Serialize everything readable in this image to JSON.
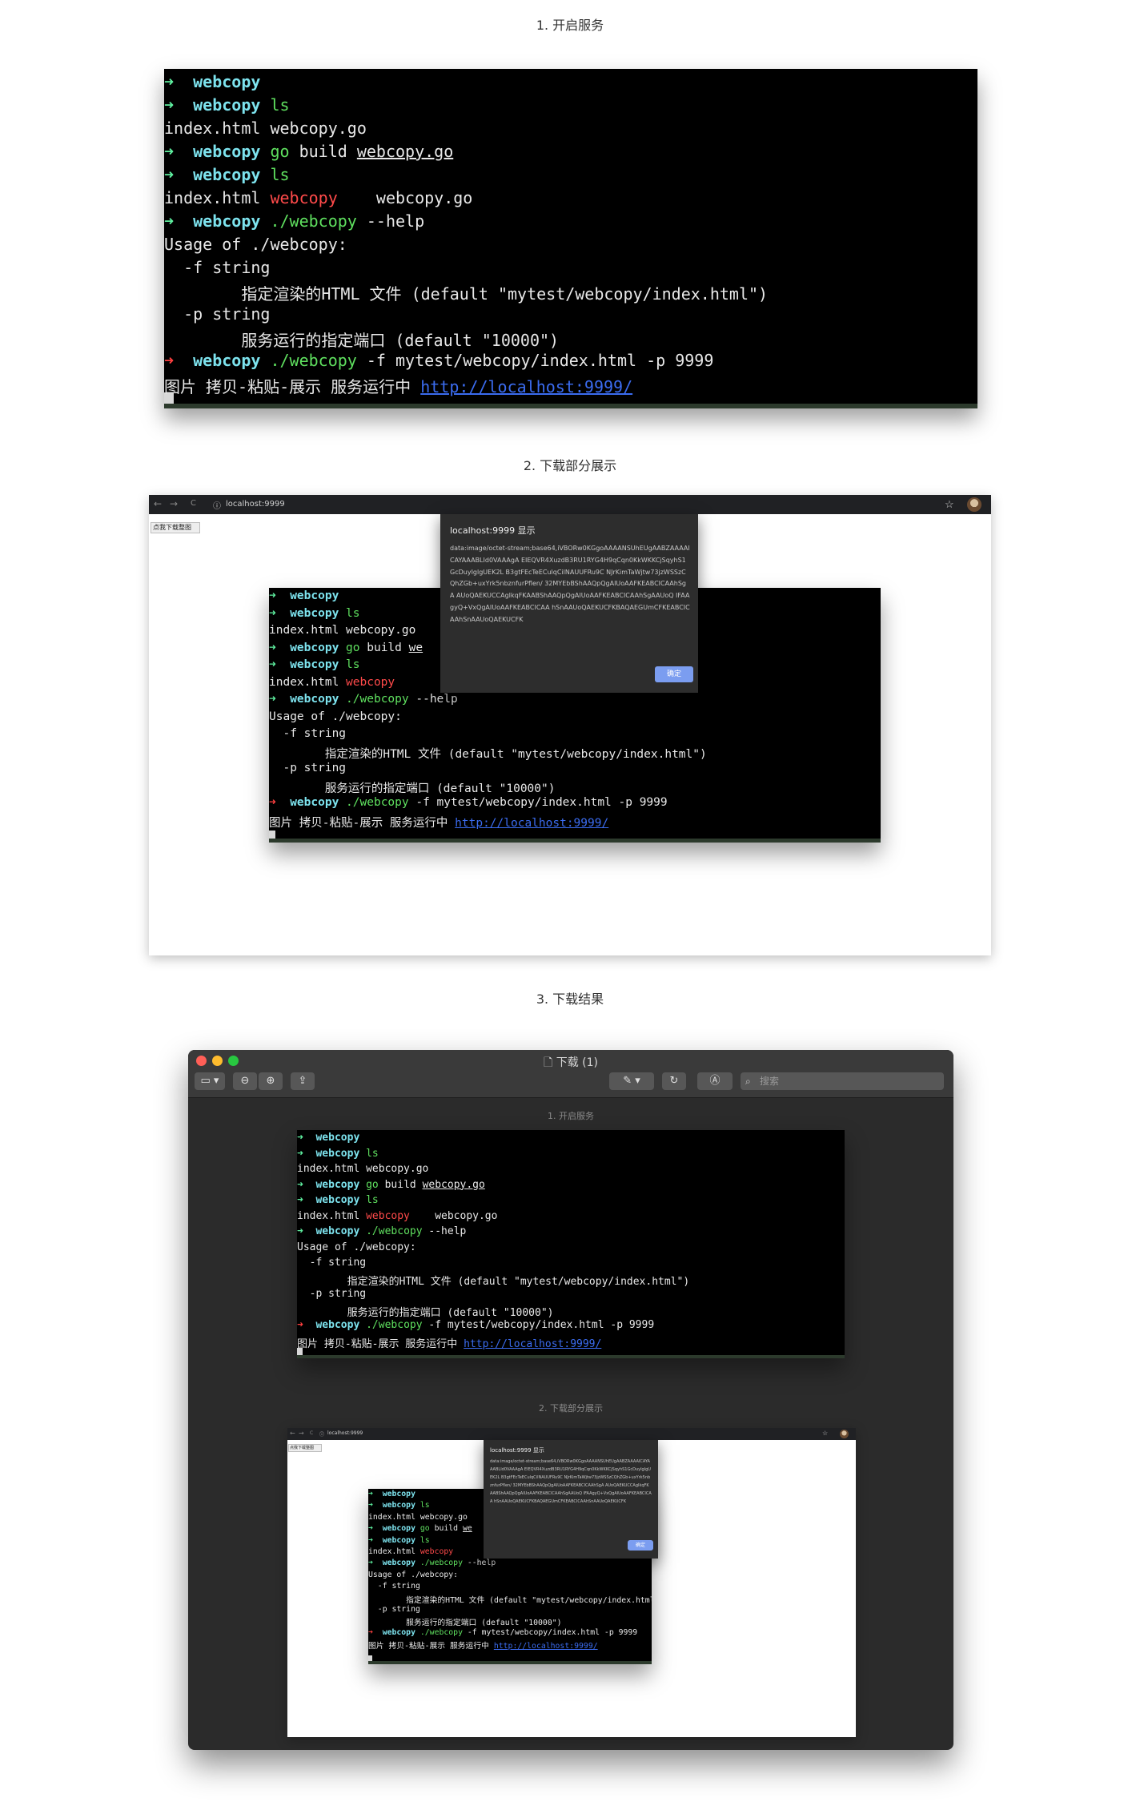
{
  "captions": {
    "step1": "1. 开启服务",
    "step2": "2. 下载部分展示",
    "step3": "3. 下载结果"
  },
  "terminal": {
    "lines": [
      [
        {
          "t": "➜ ",
          "c": "arrow-ok"
        },
        {
          "t": " webcopy",
          "c": "cwd"
        }
      ],
      [
        {
          "t": "➜ ",
          "c": "arrow-ok"
        },
        {
          "t": " webcopy",
          "c": "cwd"
        },
        {
          "t": " ls",
          "c": "cmd"
        }
      ],
      [
        {
          "t": "index.html webcopy.go",
          "c": ""
        }
      ],
      [
        {
          "t": "➜ ",
          "c": "arrow-ok"
        },
        {
          "t": " webcopy",
          "c": "cwd"
        },
        {
          "t": " go",
          "c": "cmd"
        },
        {
          "t": " build ",
          "c": ""
        },
        {
          "t": "webcopy.go",
          "c": "ul"
        }
      ],
      [
        {
          "t": "➜ ",
          "c": "arrow-ok"
        },
        {
          "t": " webcopy",
          "c": "cwd"
        },
        {
          "t": " ls",
          "c": "cmd"
        }
      ],
      [
        {
          "t": "index.html ",
          "c": ""
        },
        {
          "t": "webcopy",
          "c": "red"
        },
        {
          "t": "    webcopy.go",
          "c": ""
        }
      ],
      [
        {
          "t": "➜ ",
          "c": "arrow-ok"
        },
        {
          "t": " webcopy",
          "c": "cwd"
        },
        {
          "t": " ./webcopy",
          "c": "cmd"
        },
        {
          "t": " --help",
          "c": ""
        }
      ],
      [
        {
          "t": "Usage of ./webcopy:",
          "c": ""
        }
      ],
      [
        {
          "t": "  -f string",
          "c": ""
        }
      ],
      [
        {
          "t": "        指定渲染的HTML 文件 (default \"mytest/webcopy/index.html\")",
          "c": ""
        }
      ],
      [
        {
          "t": "  -p string",
          "c": ""
        }
      ],
      [
        {
          "t": "        服务运行的指定端口 (default \"10000\")",
          "c": ""
        }
      ],
      [
        {
          "t": "➜ ",
          "c": "arrow-err"
        },
        {
          "t": " webcopy",
          "c": "cwd"
        },
        {
          "t": " ./webcopy",
          "c": "cmd"
        },
        {
          "t": " -f mytest/webcopy/index.html -p 9999",
          "c": ""
        }
      ],
      [
        {
          "t": "图片 拷贝-粘贴-展示 服务运行中 ",
          "c": ""
        },
        {
          "t": "http://localhost:9999/",
          "c": "link"
        }
      ]
    ]
  },
  "terminal_partial": {
    "lines": [
      [
        {
          "t": "➜ ",
          "c": "arrow-ok"
        },
        {
          "t": " webcopy",
          "c": "cwd"
        }
      ],
      [
        {
          "t": "➜ ",
          "c": "arrow-ok"
        },
        {
          "t": " webcopy",
          "c": "cwd"
        },
        {
          "t": " ls",
          "c": "cmd"
        }
      ],
      [
        {
          "t": "index.html webcopy.go",
          "c": ""
        }
      ],
      [
        {
          "t": "➜ ",
          "c": "arrow-ok"
        },
        {
          "t": " webcopy",
          "c": "cwd"
        },
        {
          "t": " go",
          "c": "cmd"
        },
        {
          "t": " build ",
          "c": ""
        },
        {
          "t": "we",
          "c": "ul"
        }
      ],
      [
        {
          "t": "➜ ",
          "c": "arrow-ok"
        },
        {
          "t": " webcopy",
          "c": "cwd"
        },
        {
          "t": " ls",
          "c": "cmd"
        }
      ],
      [
        {
          "t": "index.html ",
          "c": ""
        },
        {
          "t": "webcopy",
          "c": "red"
        }
      ],
      [
        {
          "t": "➜ ",
          "c": "arrow-ok"
        },
        {
          "t": " webcopy",
          "c": "cwd"
        },
        {
          "t": " ./webcopy",
          "c": "cmd"
        },
        {
          "t": " --help",
          "c": ""
        }
      ],
      [
        {
          "t": "Usage of ./webcopy:",
          "c": ""
        }
      ],
      [
        {
          "t": "  -f string",
          "c": ""
        }
      ],
      [
        {
          "t": "        指定渲染的HTML 文件 (default \"mytest/webcopy/index.html\")",
          "c": ""
        }
      ],
      [
        {
          "t": "  -p string",
          "c": ""
        }
      ],
      [
        {
          "t": "        服务运行的指定端口 (default \"10000\")",
          "c": ""
        }
      ],
      [
        {
          "t": "➜ ",
          "c": "arrow-err"
        },
        {
          "t": " webcopy",
          "c": "cwd"
        },
        {
          "t": " ./webcopy",
          "c": "cmd"
        },
        {
          "t": " -f mytest/webcopy/index.html -p 9999",
          "c": ""
        }
      ],
      [
        {
          "t": "图片 拷贝-粘贴-展示 服务运行中 ",
          "c": ""
        },
        {
          "t": "http://localhost:9999/",
          "c": "link"
        }
      ]
    ]
  },
  "browser": {
    "url": "localhost:9999",
    "nav_back": "←",
    "nav_forward": "→",
    "nav_reload": "C",
    "info_icon": "ⓘ",
    "star": "☆",
    "download_button": "点我下载整图",
    "dialog": {
      "title": "localhost:9999 显示",
      "body": "data:image/octet-stream;base64,iVBORw0KGgoAAAANSUhEUgAABZAAAAICAYAAABLId0VAAAgA EIEQVR4XuzdB3RU1RYG4H9qCqn0KkWKKCjSqyhS1GcDuyIglgUEK2L B3gtFEcTeECulqCilNAUUFRu9C NJrKimTaWjtw73jzWSSzCQhZGb+uxYrk5nbznfurPflen/ 32MYEbBShAAQpQgAIUoAAFKEABCICAAhSgA AUoQAEKUCCAgIkqFKAABShAAQpQgAIUoAAFKEABCICAAhSgAAUoQ IFAAgyQ+VxQgAIUoAAFKEABCICAA hSnAAUoQAEKUCFKBAQAEGUmCFKEABCICAAhSnAAUoQAEKUCFK"
    },
    "ok": "确定"
  },
  "preview": {
    "title": "下载 (1)",
    "search_placeholder": "搜索",
    "inner_caption1": "1. 开启服务",
    "inner_caption2": "2. 下载部分展示",
    "colors": {
      "close": "#ff5f57",
      "minimize": "#febc2e",
      "zoom": "#28c840"
    }
  }
}
